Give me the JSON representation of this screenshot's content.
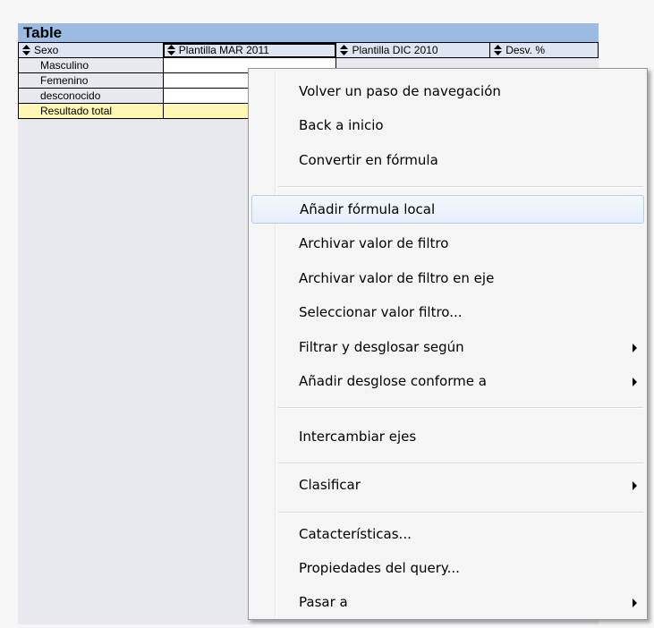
{
  "table": {
    "title": "Table",
    "headers": [
      "Sexo",
      "Plantilla MAR 2011",
      "Plantilla DIC 2010",
      "Desv. %"
    ],
    "rows": [
      "Masculino",
      "Femenino",
      "desconocido"
    ],
    "total_label": "Resultado total"
  },
  "colors": {
    "title_bar": "#9bbbe3",
    "total_row": "#fff7b3",
    "menu_highlight_border": "#aecff7"
  },
  "context_menu": {
    "items": [
      {
        "label": "Volver un paso de navegación",
        "submenu": false
      },
      {
        "label": "Back a inicio",
        "submenu": false
      },
      {
        "label": "Convertir en fórmula",
        "submenu": false
      },
      {
        "label": "Añadir fórmula local",
        "submenu": false,
        "highlighted": true
      },
      {
        "label": "Archivar valor de filtro",
        "submenu": false
      },
      {
        "label": "Archivar valor de filtro en eje",
        "submenu": false
      },
      {
        "label": "Seleccionar valor filtro...",
        "submenu": false
      },
      {
        "label": "Filtrar y desglosar según",
        "submenu": true
      },
      {
        "label": "Añadir desglose conforme a",
        "submenu": true
      },
      {
        "label": "Intercambiar ejes",
        "submenu": false
      },
      {
        "label": "Clasificar",
        "submenu": true
      },
      {
        "label": "Catacterísticas...",
        "submenu": false
      },
      {
        "label": "Propiedades del query...",
        "submenu": false
      },
      {
        "label": "Pasar a",
        "submenu": true
      }
    ]
  }
}
